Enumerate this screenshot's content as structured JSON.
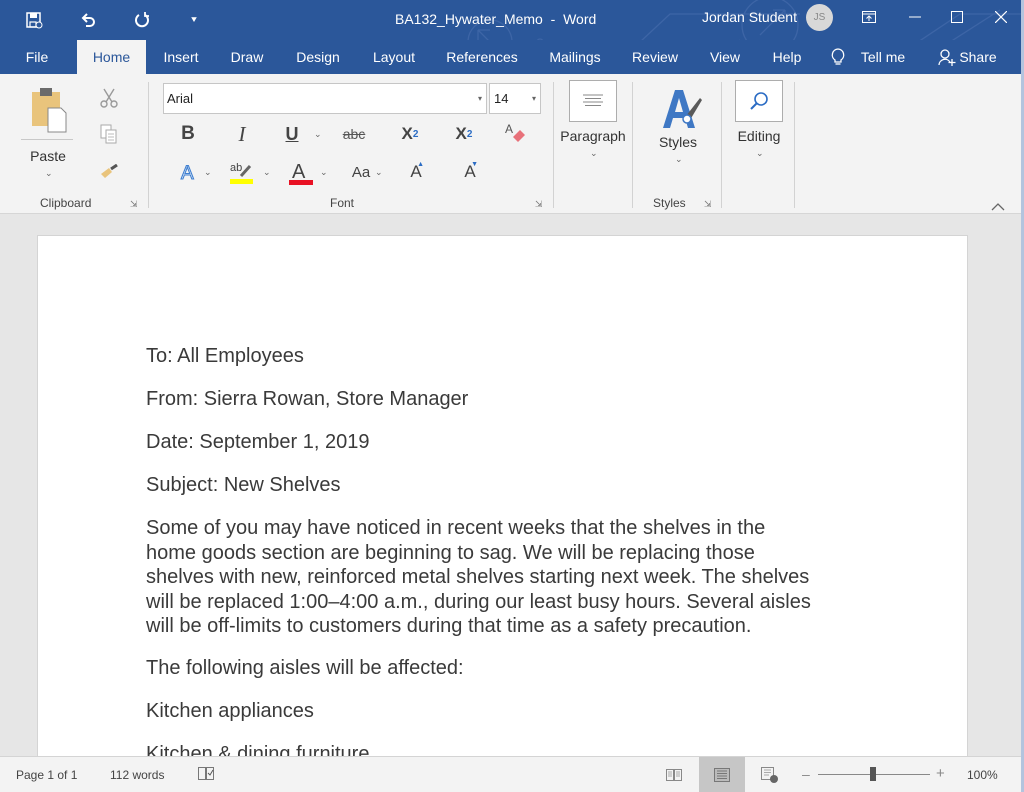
{
  "window": {
    "document_title": "BA132_Hywater_Memo  -  Word",
    "user_name": "Jordan Student",
    "user_initials": "JS"
  },
  "quick_access": [
    {
      "name": "save-icon"
    },
    {
      "name": "undo-icon"
    },
    {
      "name": "redo-icon"
    },
    {
      "name": "customize-qat-icon"
    }
  ],
  "window_controls": [
    "ribbon-display-options",
    "minimize",
    "maximize",
    "close"
  ],
  "tabs": [
    {
      "label": "File"
    },
    {
      "label": "Home",
      "active": true
    },
    {
      "label": "Insert"
    },
    {
      "label": "Draw"
    },
    {
      "label": "Design"
    },
    {
      "label": "Layout"
    },
    {
      "label": "References"
    },
    {
      "label": "Mailings"
    },
    {
      "label": "Review"
    },
    {
      "label": "View"
    },
    {
      "label": "Help"
    }
  ],
  "tell_me": "Tell me",
  "share": "Share",
  "ribbon": {
    "clipboard": {
      "label": "Clipboard",
      "paste": "Paste"
    },
    "font": {
      "label": "Font",
      "font_name": "Arial",
      "font_size": "14",
      "bold": "B",
      "italic": "I",
      "underline": "U",
      "strikethrough": "abc",
      "subscript": "X",
      "subscript_mark": "2",
      "superscript": "X",
      "superscript_mark": "2",
      "change_case": "Aa",
      "grow": "A",
      "shrink": "A",
      "text_effects": "A",
      "font_color": "A",
      "highlight_colors": {
        "highlight": "#ffff00",
        "font_color": "#e81123"
      }
    },
    "paragraph": {
      "label": "Paragraph"
    },
    "styles": {
      "label": "Styles",
      "button": "Styles"
    },
    "editing": {
      "label": "Editing"
    }
  },
  "document": {
    "paragraphs": [
      "To: All Employees",
      "From: Sierra Rowan, Store Manager",
      "Date: September 1, 2019",
      "Subject: New Shelves"
    ],
    "body_lines": [
      "Some of you may have noticed in recent weeks that the shelves in the",
      "home goods section are beginning to sag. We will be replacing those",
      "shelves with new, reinforced metal shelves starting next week. The shelves",
      "will be replaced 1:00–4:00 a.m., during our least busy hours. Several aisles",
      "will be off-limits to customers during that time as a safety precaution."
    ],
    "after": [
      "The following aisles will be affected:",
      "Kitchen appliances",
      "Kitchen & dining furniture"
    ]
  },
  "status": {
    "page": "Page 1 of 1",
    "words": "112 words",
    "zoom_level": "100%",
    "zoom_percent": 100,
    "minus": "–",
    "plus": "+"
  }
}
